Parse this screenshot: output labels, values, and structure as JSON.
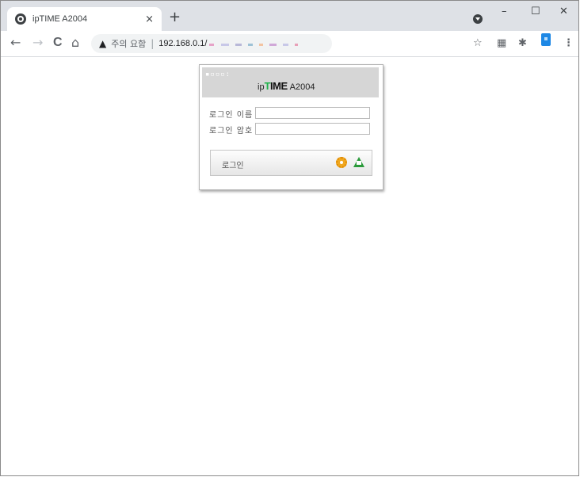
{
  "browser": {
    "tab": {
      "title": "ipTIME A2004",
      "close": "×"
    },
    "new_tab": "+",
    "window_controls": {
      "minimize": "–",
      "maximize": "☐",
      "close": "✕"
    },
    "toolbar": {
      "back": "←",
      "forward": "→",
      "reload": "C",
      "home": "⌂",
      "warning_icon": "▲",
      "warning_text": "주의 요함",
      "separator": "|",
      "url": "192.168.0.1/",
      "bookmark": "☆",
      "qr": "▦",
      "extensions": "✱",
      "menu": "⋮"
    }
  },
  "login": {
    "logo_dots": "▪▫▫▫:",
    "brand_ip": "ip",
    "brand_t": "T",
    "brand_ime": "IME",
    "brand_model": "A2004",
    "username_label": "로그인 이름",
    "password_label": "로그인 암호",
    "username_value": "",
    "password_value": "",
    "button_label": "로그인"
  },
  "colors": {
    "accent_green": "#1fb24a",
    "header_gray": "#d6d6d6",
    "setup_orange": "#f0a821"
  }
}
